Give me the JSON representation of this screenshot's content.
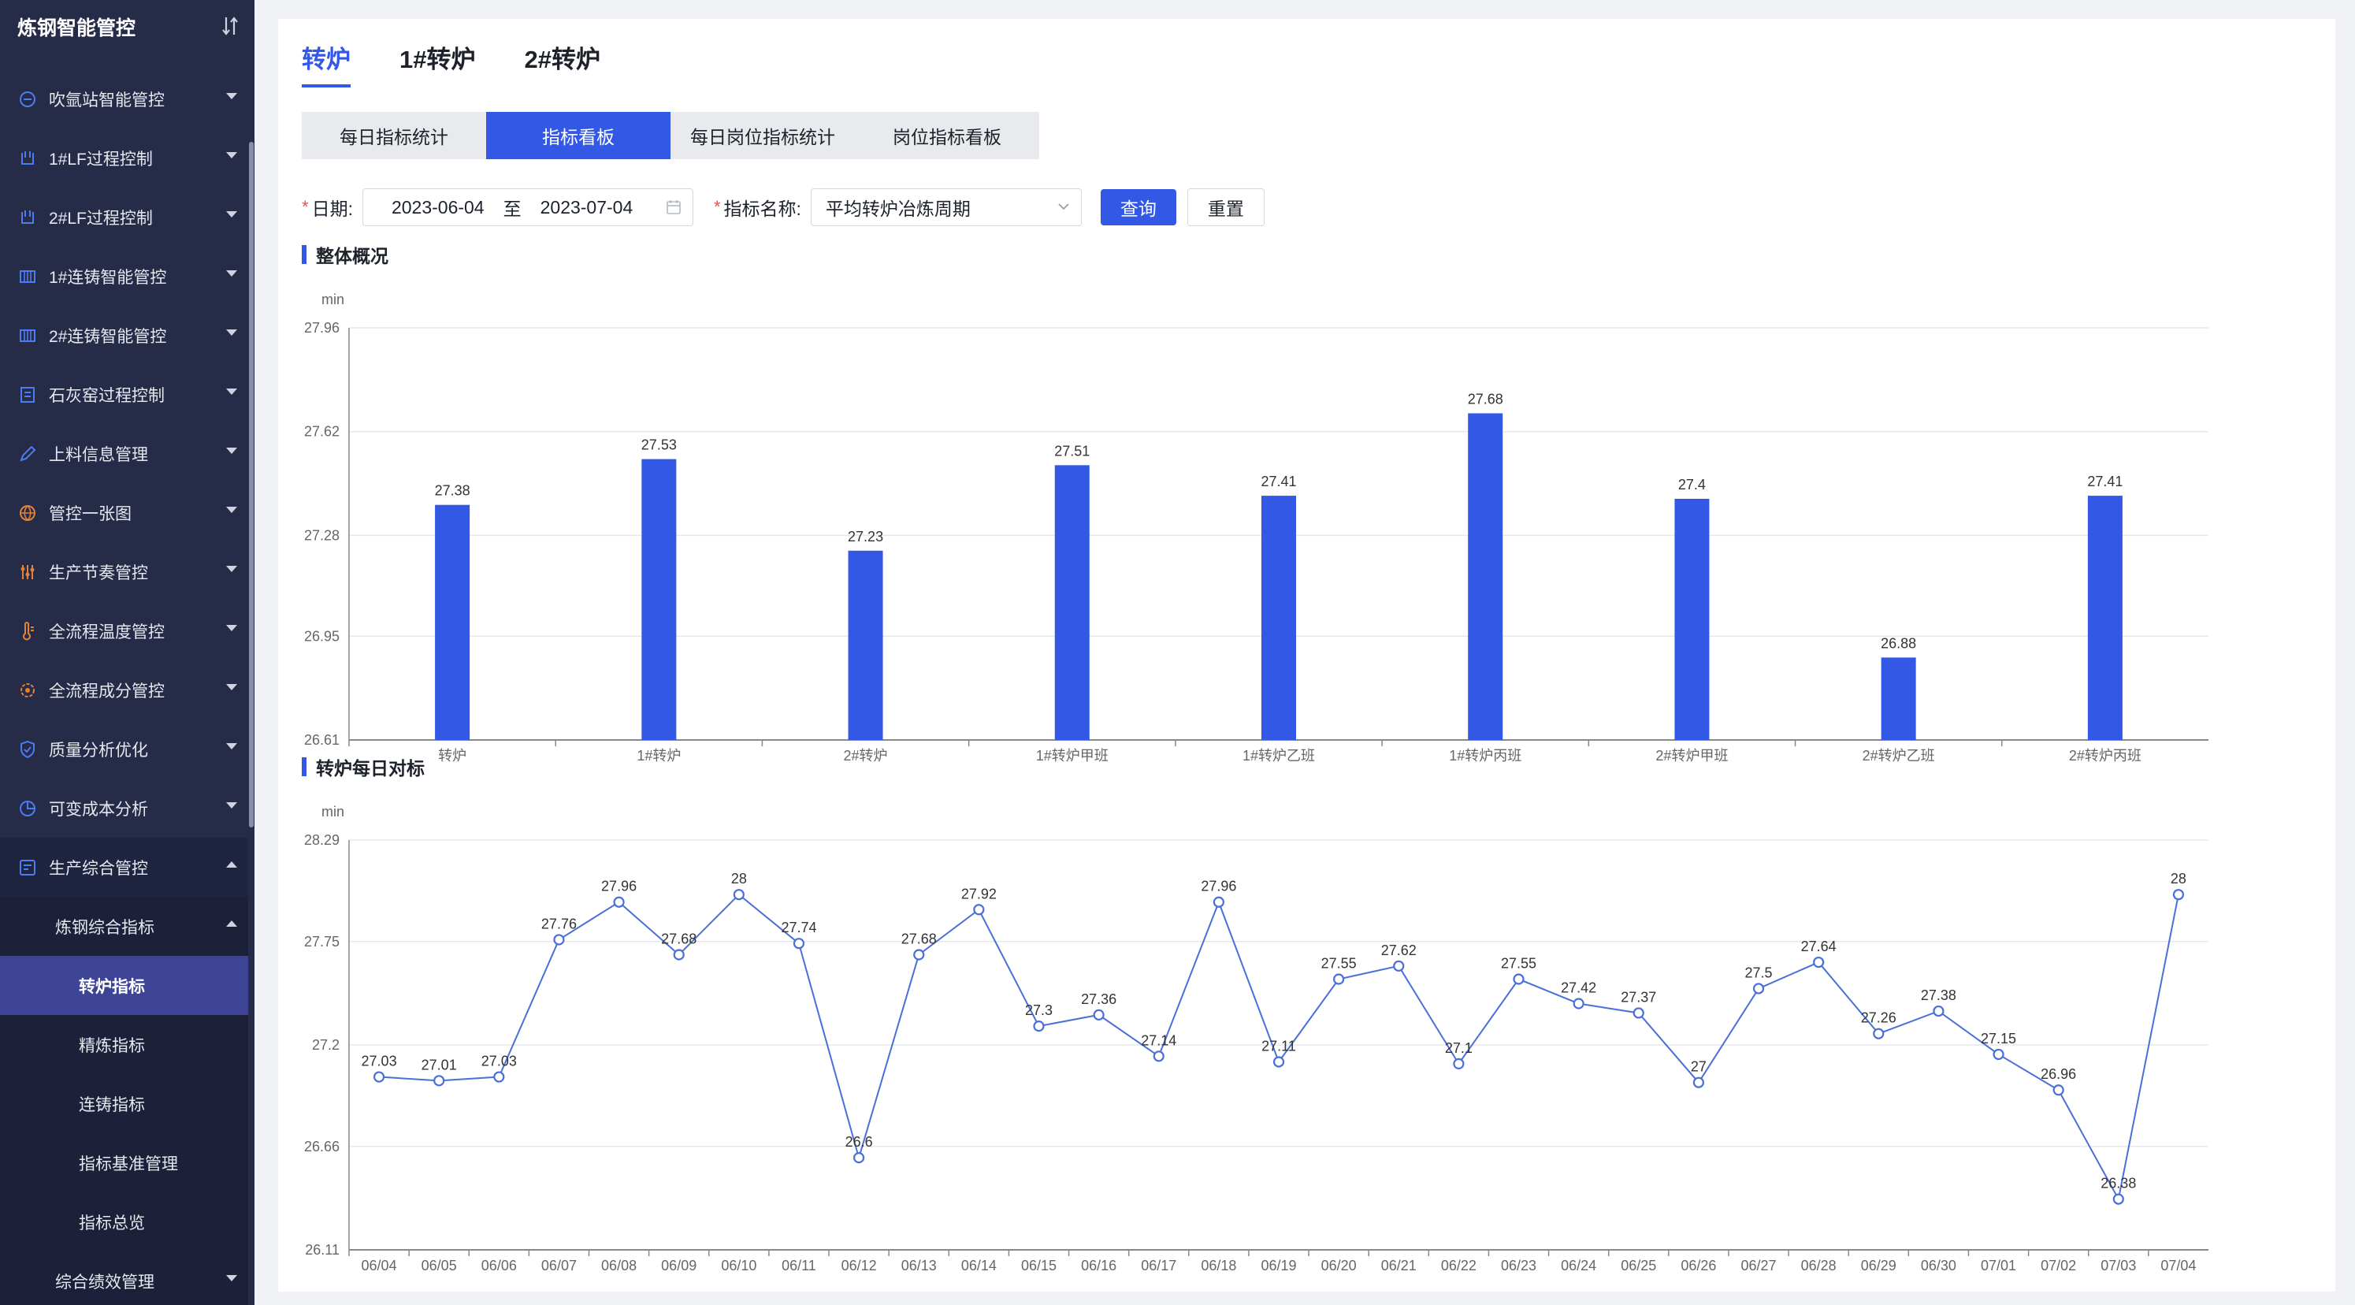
{
  "app": {
    "title": "炼钢智能管控"
  },
  "sidebar": {
    "items": [
      {
        "label": "吹氩站智能管控",
        "icon": "argon-station-icon"
      },
      {
        "label": "1#LF过程控制",
        "icon": "ladle-furnace-icon"
      },
      {
        "label": "2#LF过程控制",
        "icon": "ladle-furnace-icon"
      },
      {
        "label": "1#连铸智能管控",
        "icon": "caster-icon"
      },
      {
        "label": "2#连铸智能管控",
        "icon": "caster-icon"
      },
      {
        "label": "石灰窑过程控制",
        "icon": "kiln-icon"
      },
      {
        "label": "上料信息管理",
        "icon": "pencil-icon"
      },
      {
        "label": "管控一张图",
        "icon": "globe-icon"
      },
      {
        "label": "生产节奏管控",
        "icon": "sliders-icon"
      },
      {
        "label": "全流程温度管控",
        "icon": "thermometer-icon"
      },
      {
        "label": "全流程成分管控",
        "icon": "composition-icon"
      },
      {
        "label": "质量分析优化",
        "icon": "shield-check-icon"
      },
      {
        "label": "可变成本分析",
        "icon": "pie-chart-icon"
      }
    ],
    "open_group": {
      "label": "生产综合管控",
      "icon": "dashboard-icon"
    },
    "sub_group": {
      "label": "炼钢综合指标"
    },
    "sub_items": [
      {
        "label": "转炉指标",
        "active": true
      },
      {
        "label": "精炼指标",
        "active": false
      },
      {
        "label": "连铸指标",
        "active": false
      },
      {
        "label": "指标基准管理",
        "active": false
      },
      {
        "label": "指标总览",
        "active": false
      }
    ],
    "last_item": {
      "label": "综合绩效管理"
    }
  },
  "top_tabs": [
    {
      "label": "转炉",
      "active": true
    },
    {
      "label": "1#转炉",
      "active": false
    },
    {
      "label": "2#转炉",
      "active": false
    }
  ],
  "sub_tabs": [
    {
      "label": "每日指标统计",
      "active": false
    },
    {
      "label": "指标看板",
      "active": true
    },
    {
      "label": "每日岗位指标统计",
      "active": false
    },
    {
      "label": "岗位指标看板",
      "active": false
    }
  ],
  "filter": {
    "date_label": "日期:",
    "date_start": "2023-06-04",
    "date_sep": "至",
    "date_end": "2023-07-04",
    "metric_label": "指标名称:",
    "metric_value": "平均转炉冶炼周期",
    "query_label": "查询",
    "reset_label": "重置"
  },
  "colors": {
    "accent": "#3358e5",
    "sidebar_bg": "#262b47",
    "line": "#4a6fd8"
  },
  "chart_data": [
    {
      "type": "bar",
      "title": "整体概况",
      "ylabel": "min",
      "ylim": [
        26.61,
        27.96
      ],
      "yticks": [
        "26.61",
        "26.95",
        "27.28",
        "27.62",
        "27.96"
      ],
      "categories": [
        "转炉",
        "1#转炉",
        "2#转炉",
        "1#转炉甲班",
        "1#转炉乙班",
        "1#转炉丙班",
        "2#转炉甲班",
        "2#转炉乙班",
        "2#转炉丙班"
      ],
      "values": [
        27.38,
        27.53,
        27.23,
        27.51,
        27.41,
        27.68,
        27.4,
        26.88,
        27.41
      ],
      "value_labels": [
        "27.38",
        "27.53",
        "27.23",
        "27.51",
        "27.41",
        "27.68",
        "27.4",
        "26.88",
        "27.41"
      ],
      "grid": true,
      "legend": "none"
    },
    {
      "type": "line",
      "title": "转炉每日对标",
      "ylabel": "min",
      "ylim": [
        26.11,
        28.29
      ],
      "yticks": [
        "26.11",
        "26.66",
        "27.2",
        "27.75",
        "28.29"
      ],
      "x": [
        "06/04",
        "06/05",
        "06/06",
        "06/07",
        "06/08",
        "06/09",
        "06/10",
        "06/11",
        "06/12",
        "06/13",
        "06/14",
        "06/15",
        "06/16",
        "06/17",
        "06/18",
        "06/19",
        "06/20",
        "06/21",
        "06/22",
        "06/23",
        "06/24",
        "06/25",
        "06/26",
        "06/27",
        "06/28",
        "06/29",
        "06/30",
        "07/01",
        "07/02",
        "07/03",
        "07/04"
      ],
      "values": [
        27.03,
        27.01,
        27.03,
        27.76,
        27.96,
        27.68,
        28,
        27.74,
        26.6,
        27.68,
        27.92,
        27.3,
        27.36,
        27.14,
        27.96,
        27.11,
        27.55,
        27.62,
        27.1,
        27.55,
        27.42,
        27.37,
        27,
        27.5,
        27.64,
        27.26,
        27.38,
        27.15,
        26.96,
        26.38,
        28
      ],
      "value_labels": [
        "27.03",
        "27.01",
        "27.03",
        "27.76",
        "27.96",
        "27.68",
        "28",
        "27.74",
        "26.6",
        "27.68",
        "27.92",
        "27.3",
        "27.36",
        "27.14",
        "27.96",
        "27.11",
        "27.55",
        "27.62",
        "27.1",
        "27.55",
        "27.42",
        "27.37",
        "27",
        "27.5",
        "27.64",
        "27.26",
        "27.38",
        "27.15",
        "26.96",
        "26.38",
        "28"
      ],
      "grid": true,
      "legend": "none"
    }
  ]
}
